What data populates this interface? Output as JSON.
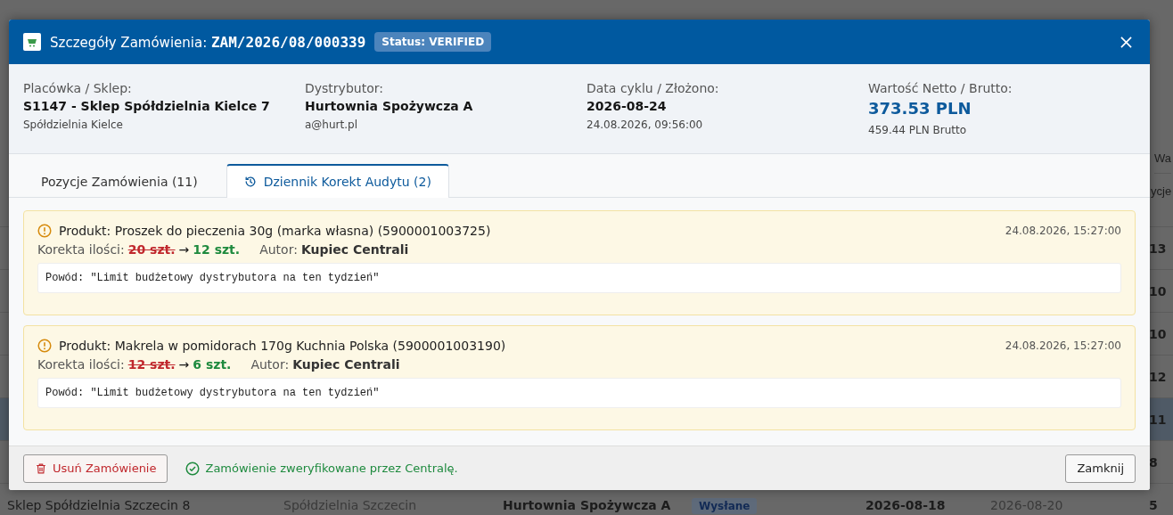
{
  "background_table": {
    "header_fragments": [
      "Wa",
      "ycje"
    ],
    "rows": [
      {
        "quantity": "13",
        "selected": false
      },
      {
        "quantity": "10",
        "selected": false
      },
      {
        "quantity": "10",
        "selected": false
      },
      {
        "quantity": "12",
        "selected": false
      },
      {
        "quantity": "11",
        "selected": true
      },
      {
        "quantity": "8",
        "selected": false
      },
      {
        "store": "Sklep Spółdzielnia Szczecin 8",
        "cooperative": "Spółdzielnia Szczecin",
        "distributor": "Hurtownia Spożywcza A",
        "status": "Wysłane",
        "cycle_date": "2026-08-18",
        "delivery_date": "2026-08-20",
        "quantity": "5",
        "selected": false
      }
    ]
  },
  "modal": {
    "title": "Szczegóły Zamówienia:",
    "order_number": "ZAM/2026/08/000339",
    "status_badge": "Status: VERIFIED",
    "info": [
      {
        "kind": "text",
        "label": "Placówka / Sklep:",
        "value": "S1147 - Sklep Spółdzielnia Kielce 7",
        "sub": "Spółdzielnia Kielce"
      },
      {
        "kind": "text",
        "label": "Dystrybutor:",
        "value": "Hurtownia Spożywcza A",
        "sub": "a@hurt.pl"
      },
      {
        "kind": "text",
        "label": "Data cyklu / Złożono:",
        "value": "2026-08-24",
        "sub": "24.08.2026, 09:56:00"
      },
      {
        "kind": "amount",
        "label": "Wartość Netto / Brutto:",
        "value": "373.53 PLN",
        "sub": "459.44 PLN Brutto"
      }
    ],
    "tabs": [
      {
        "kind": "plain",
        "label": "Pozycje Zamówienia (11)",
        "selected": false
      },
      {
        "kind": "history",
        "label": "Dziennik Korekt Audytu (2)",
        "selected": true
      }
    ],
    "entries": [
      {
        "product": "Produkt: Proszek do pieczenia 30g (marka własna) (5900001003725)",
        "timestamp": "24.08.2026, 15:27:00",
        "correction_label": "Korekta ilości:",
        "old_quantity": "20 szt.",
        "arrow": "→",
        "new_quantity": "12 szt.",
        "author_label": "Autor:",
        "author": "Kupiec Centrali",
        "reason": "Powód: \"Limit budżetowy dystrybutora na ten tydzień\""
      },
      {
        "product": "Produkt: Makrela w pomidorach 170g Kuchnia Polska (5900001003190)",
        "timestamp": "24.08.2026, 15:27:00",
        "correction_label": "Korekta ilości:",
        "old_quantity": "12 szt.",
        "arrow": "→",
        "new_quantity": "6 szt.",
        "author_label": "Autor:",
        "author": "Kupiec Centrali",
        "reason": "Powód: \"Limit budżetowy dystrybutora na ten tydzień\""
      }
    ],
    "delete_button": "Usuń Zamówienie",
    "verified_message": "Zamówienie zweryfikowane przez Centralę.",
    "close_button": "Zamknij"
  }
}
